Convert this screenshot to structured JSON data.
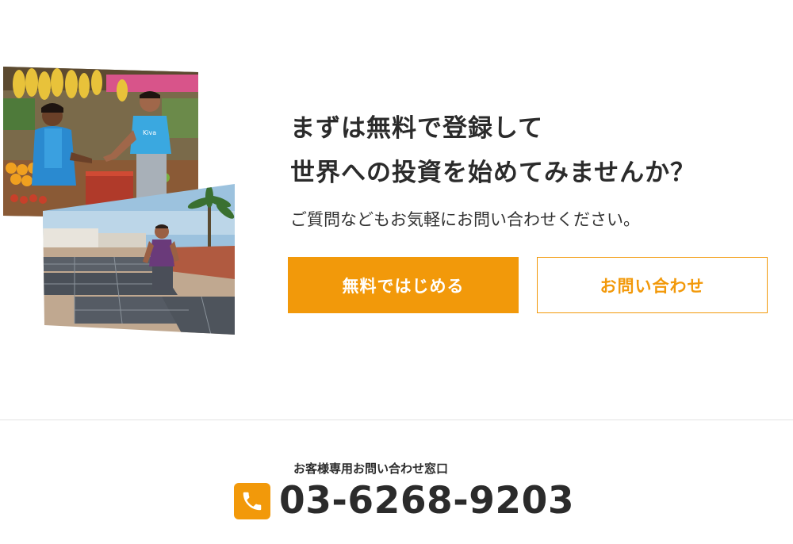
{
  "cta": {
    "headline_line1": "まずは無料で登録して",
    "headline_line2": "世界への投資を始めてみませんか？",
    "subtext": "ご質問などもお気軽にお問い合わせください。",
    "primary_button_label": "無料ではじめる",
    "secondary_button_label": "お問い合わせ"
  },
  "contact": {
    "label": "お客様専用お問い合わせ窓口",
    "phone_number": "03-6268-9203",
    "icon": "phone-icon"
  },
  "colors": {
    "accent": "#f2990a",
    "text": "#2b2b2b",
    "divider": "#e3e3e3"
  }
}
